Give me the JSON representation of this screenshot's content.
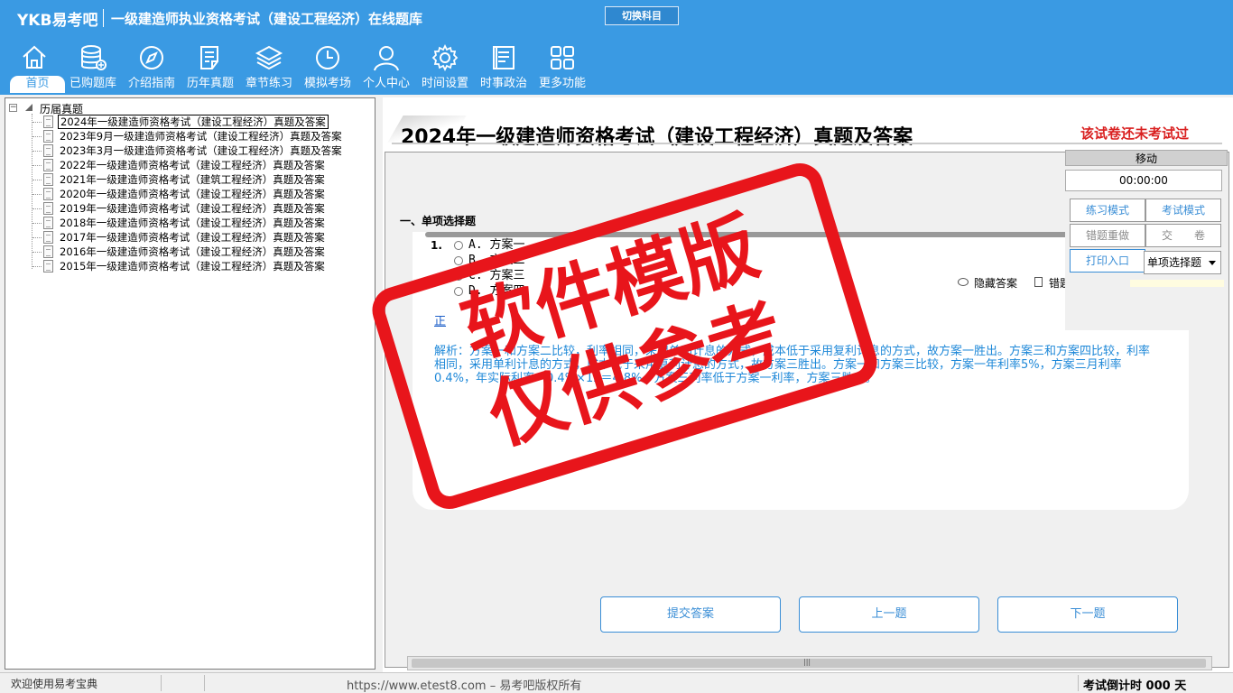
{
  "header": {
    "logo": "YKB易考吧",
    "title": "一级建造师执业资格考试（建设工程经济）在线题库",
    "switch_label": "切换科目"
  },
  "nav": [
    {
      "label": "首页",
      "icon": "home-icon"
    },
    {
      "label": "已购题库",
      "icon": "database-icon"
    },
    {
      "label": "介绍指南",
      "icon": "compass-icon"
    },
    {
      "label": "历年真题",
      "icon": "document-list-icon"
    },
    {
      "label": "章节练习",
      "icon": "layers-icon"
    },
    {
      "label": "模拟考场",
      "icon": "clock-icon"
    },
    {
      "label": "个人中心",
      "icon": "user-icon"
    },
    {
      "label": "时间设置",
      "icon": "gear-icon"
    },
    {
      "label": "时事政治",
      "icon": "news-icon"
    },
    {
      "label": "更多功能",
      "icon": "grid-icon"
    }
  ],
  "tree": {
    "root": "历届真题",
    "items": [
      "2024年一级建造师资格考试（建设工程经济）真题及答案",
      "2023年9月一级建造师资格考试（建设工程经济）真题及答案",
      "2023年3月一级建造师资格考试（建设工程经济）真题及答案",
      "2022年一级建造师资格考试（建设工程经济）真题及答案",
      "2021年一级建造师资格考试（建筑工程经济）真题及答案",
      "2020年一级建造师资格考试（建设工程经济）真题及答案",
      "2019年一级建造师资格考试（建设工程经济）真题及答案",
      "2018年一级建造师资格考试（建设工程经济）真题及答案",
      "2017年一级建造师资格考试（建设工程经济）真题及答案",
      "2016年一级建造师资格考试（建设工程经济）真题及答案",
      "2015年一级建造师资格考试（建设工程经济）真题及答案"
    ]
  },
  "paper": {
    "title": "2024年一级建造师资格考试（建设工程经济）真题及答案",
    "status": "该试卷还未考试过",
    "section": "一、单项选择题",
    "question_number": "1.",
    "options": [
      "A. 方案一",
      "B. 方案二",
      "C. 方案三",
      "D. 方案四"
    ],
    "hide_answer": "隐藏答案",
    "error_label": "错题",
    "correct_label": "正",
    "explanation": "解析：方案一和方案二比较，利率相同，采用单利计息的方式，成本低于采用复利计息的方式，故方案一胜出。方案三和方案四比较，利率相同，采用单利计息的方式，成本低于采用复利计息的方式，故方案三胜出。方案一和方案三比较，方案一年利率5%，方案三月利率0.4%，年实际利率＝0.4%×12＝4.8%，方案三利率低于方案一利率，方案三胜出。"
  },
  "control": {
    "move": "移动",
    "timer": "00:00:00",
    "practice_mode": "练习模式",
    "exam_mode": "考试模式",
    "redo_wrong": "错题重做",
    "submit_paper": "交　　卷",
    "print": "打印入口",
    "question_type": "单项选择题"
  },
  "buttons": {
    "submit": "提交答案",
    "prev": "上一题",
    "next": "下一题"
  },
  "status": {
    "welcome": "欢迎使用易考宝典",
    "copyright": "https://www.etest8.com – 易考吧版权所有",
    "countdown": "考试倒计时 000 天"
  },
  "watermark": {
    "line1": "软件模版",
    "line2": "仅供参考"
  },
  "colors": {
    "header_blue": "#3a9ae3",
    "stamp_red": "#e8151b",
    "status_red": "#d92020",
    "link_blue": "#1e88d8"
  }
}
